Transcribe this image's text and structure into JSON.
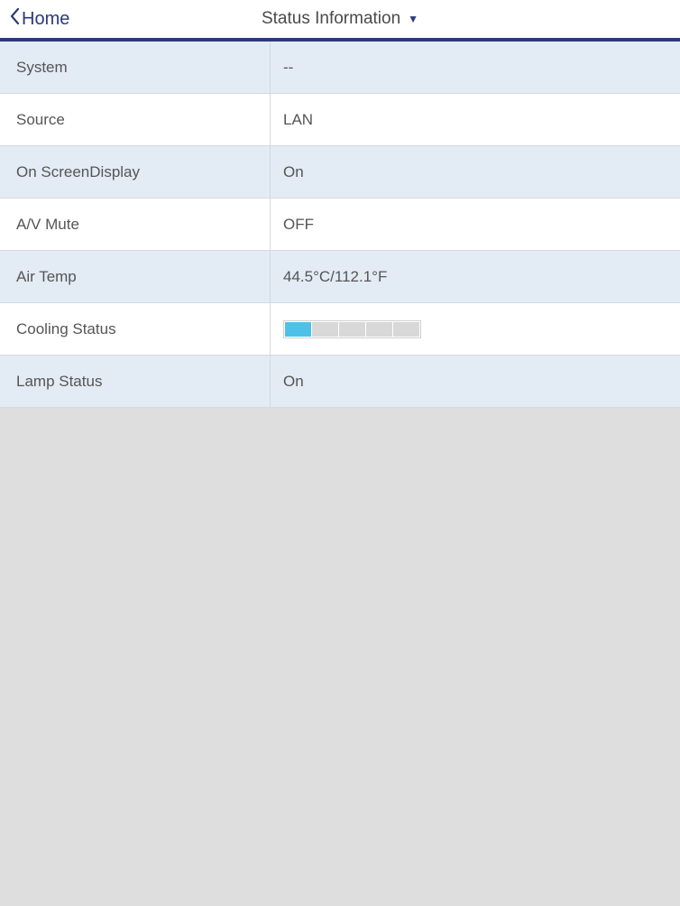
{
  "header": {
    "home_label": "Home",
    "title": "Status Information"
  },
  "rows": [
    {
      "label": "System",
      "value": "--"
    },
    {
      "label": "Source",
      "value": "LAN"
    },
    {
      "label": "On ScreenDisplay",
      "value": "On"
    },
    {
      "label": "A/V Mute",
      "value": "OFF"
    },
    {
      "label": "Air Temp",
      "value": "44.5°C/112.1°F"
    },
    {
      "label": "Cooling Status",
      "cooling": {
        "segments": 5,
        "active": 1
      }
    },
    {
      "label": "Lamp Status",
      "value": "On"
    }
  ]
}
